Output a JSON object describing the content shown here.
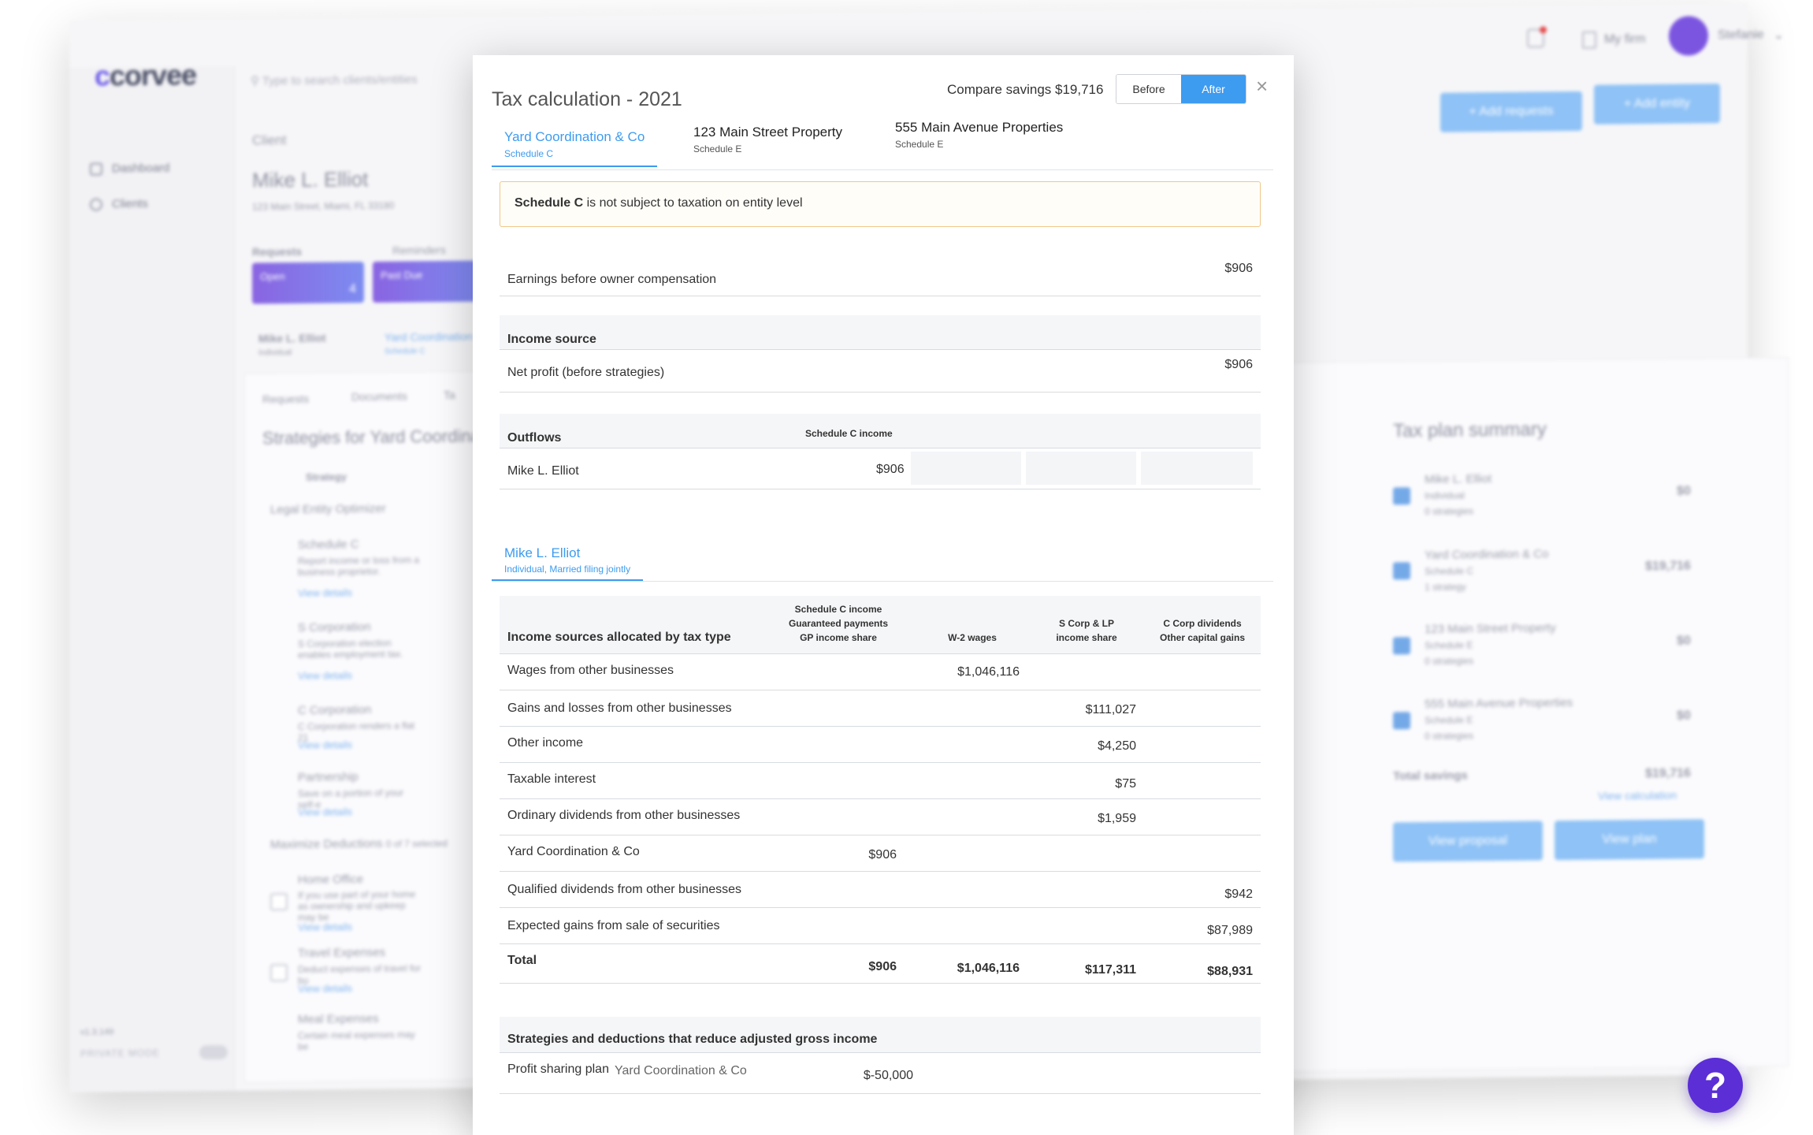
{
  "app": {
    "brand": "corvee",
    "search_placeholder": "Type to search clients/entities",
    "sidebar": [
      {
        "label": "Dashboard"
      },
      {
        "label": "Clients"
      }
    ],
    "version": "v1.3.149",
    "private_mode": "PRIVATE MODE",
    "topbar": {
      "my_firm": "My firm",
      "user": "Stefanie"
    },
    "client_label": "Client",
    "client_name": "Mike L. Elliot",
    "client_address": "123 Main Street, Miami, FL 33180",
    "requests_label": "Requests",
    "reminders_label": "Reminders",
    "chip_open": "Open",
    "chip_open_count": "4",
    "chip_pastdue": "Past Due",
    "entity_tab_1": "Mike L. Elliot",
    "entity_tab_1_sub": "Individual",
    "entity_tab_2": "Yard Coordination",
    "entity_tab_2_sub": "Schedule C",
    "sub_tabs": [
      "Requests",
      "Documents",
      "Ta"
    ],
    "strategies_title": "Strategies for Yard Coordination",
    "strategy_col": "Strategy",
    "legal_entity": "Legal Entity Optimizer",
    "strategies": [
      {
        "name": "Schedule C",
        "desc": "Report income or loss from a business proprietor."
      },
      {
        "name": "S Corporation",
        "desc": "S Corporation election enables employment tax."
      },
      {
        "name": "C Corporation",
        "desc": "C Corporation renders a flat 21"
      },
      {
        "name": "Partnership",
        "desc": "Save on a portion of your self-e"
      }
    ],
    "view_details": "View details",
    "maximize": "Maximize Deductions",
    "maximize_count": "0 of 7 selected",
    "deductions": [
      {
        "name": "Home Office",
        "desc": "If you use part of your home as ownership and upkeep may be"
      },
      {
        "name": "Travel Expenses",
        "desc": "Deduct expenses of travel for bu"
      },
      {
        "name": "Meal Expenses",
        "desc": "Certain meal expenses may be"
      }
    ],
    "add_requests": "+ Add requests",
    "add_entity": "+ Add entity",
    "tax_plan_summary": "Tax plan summary",
    "summary_items": [
      {
        "name": "Mike L. Elliot",
        "sub": "Individual",
        "sub2": "0 strategies",
        "value": "$0"
      },
      {
        "name": "Yard Coordination & Co",
        "sub": "Schedule C",
        "sub2": "1 strategy",
        "value": "$19,716"
      },
      {
        "name": "123 Main Street Property",
        "sub": "Schedule E",
        "sub2": "0 strategies",
        "value": "$0"
      },
      {
        "name": "555 Main Avenue Properties",
        "sub": "Schedule E",
        "sub2": "0 strategies",
        "value": "$0"
      }
    ],
    "total_savings_label": "Total savings",
    "total_savings": "$19,716",
    "view_calculation": "View calculation",
    "view_proposal": "View proposal",
    "view_plan": "View plan"
  },
  "modal": {
    "title": "Tax calculation - 2021",
    "compare_label": "Compare savings $19,716",
    "toggle": {
      "before": "Before",
      "after": "After",
      "active": "after"
    },
    "close_glyph": "×",
    "entity_tabs": [
      {
        "name": "Yard Coordination & Co",
        "sub": "Schedule C"
      },
      {
        "name": "123 Main Street Property",
        "sub": "Schedule E"
      },
      {
        "name": "555 Main Avenue Properties",
        "sub": "Schedule E"
      }
    ],
    "notice_bold": "Schedule C",
    "notice_text": " is not subject to taxation on entity level",
    "earnings_label": "Earnings before owner compensation",
    "earnings_value": "$906",
    "income_source_head": "Income source",
    "net_profit_label": "Net profit (before strategies)",
    "net_profit_value": "$906",
    "outflows_head": "Outflows",
    "outflows_col": "Schedule C income",
    "outflow_row_label": "Mike L. Elliot",
    "outflow_row_value": "$906",
    "person": {
      "name": "Mike L. Elliot",
      "sub": "Individual, Married filing jointly"
    },
    "alloc_head": "Income sources allocated by tax type",
    "alloc_cols": [
      [
        "Schedule C income",
        "Guaranteed payments",
        "GP income share"
      ],
      [
        "W-2 wages"
      ],
      [
        "S Corp & LP",
        "income share"
      ],
      [
        "C Corp dividends",
        "Other capital gains"
      ]
    ],
    "alloc_rows": [
      {
        "label": "Wages from other businesses",
        "c1": "",
        "c2": "$1,046,116",
        "c3": "",
        "c4": ""
      },
      {
        "label": "Gains and losses from other businesses",
        "c1": "",
        "c2": "",
        "c3": "$111,027",
        "c4": ""
      },
      {
        "label": "Other income",
        "c1": "",
        "c2": "",
        "c3": "$4,250",
        "c4": ""
      },
      {
        "label": "Taxable interest",
        "c1": "",
        "c2": "",
        "c3": "$75",
        "c4": ""
      },
      {
        "label": "Ordinary dividends from other businesses",
        "c1": "",
        "c2": "",
        "c3": "$1,959",
        "c4": ""
      },
      {
        "label": "Yard Coordination & Co",
        "c1": "$906",
        "c2": "",
        "c3": "",
        "c4": ""
      },
      {
        "label": "Qualified dividends from other businesses",
        "c1": "",
        "c2": "",
        "c3": "",
        "c4": "$942"
      },
      {
        "label": "Expected gains from sale of securities",
        "c1": "",
        "c2": "",
        "c3": "",
        "c4": "$87,989"
      }
    ],
    "total": {
      "label": "Total",
      "c1": "$906",
      "c2": "$1,046,116",
      "c3": "$117,311",
      "c4": "$88,931"
    },
    "strategies_head": "Strategies and deductions that reduce adjusted gross income",
    "strategy_row": {
      "label": "Profit sharing plan",
      "entity": "Yard Coordination & Co",
      "value": "$-50,000"
    }
  },
  "help": {
    "glyph": "?"
  }
}
